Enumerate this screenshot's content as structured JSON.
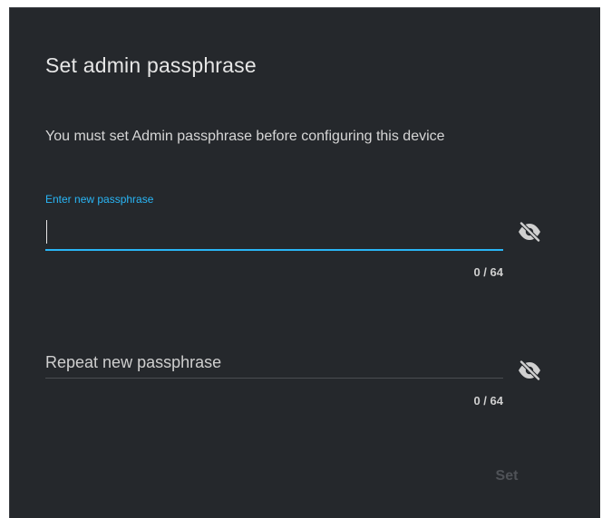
{
  "dialog": {
    "title": "Set admin passphrase",
    "message": "You must set Admin passphrase before configuring this device"
  },
  "new_passphrase": {
    "label": "Enter new passphrase",
    "value": "",
    "counter": "0 / 64",
    "visibility_icon": "eye-off-icon"
  },
  "repeat_passphrase": {
    "placeholder": "Repeat new passphrase",
    "value": "",
    "counter": "0 / 64",
    "visibility_icon": "eye-off-icon"
  },
  "actions": {
    "set_label": "Set"
  },
  "colors": {
    "background": "#25282c",
    "accent": "#29b6f6",
    "text": "#e6e6e6",
    "disabled": "#4f5257"
  }
}
